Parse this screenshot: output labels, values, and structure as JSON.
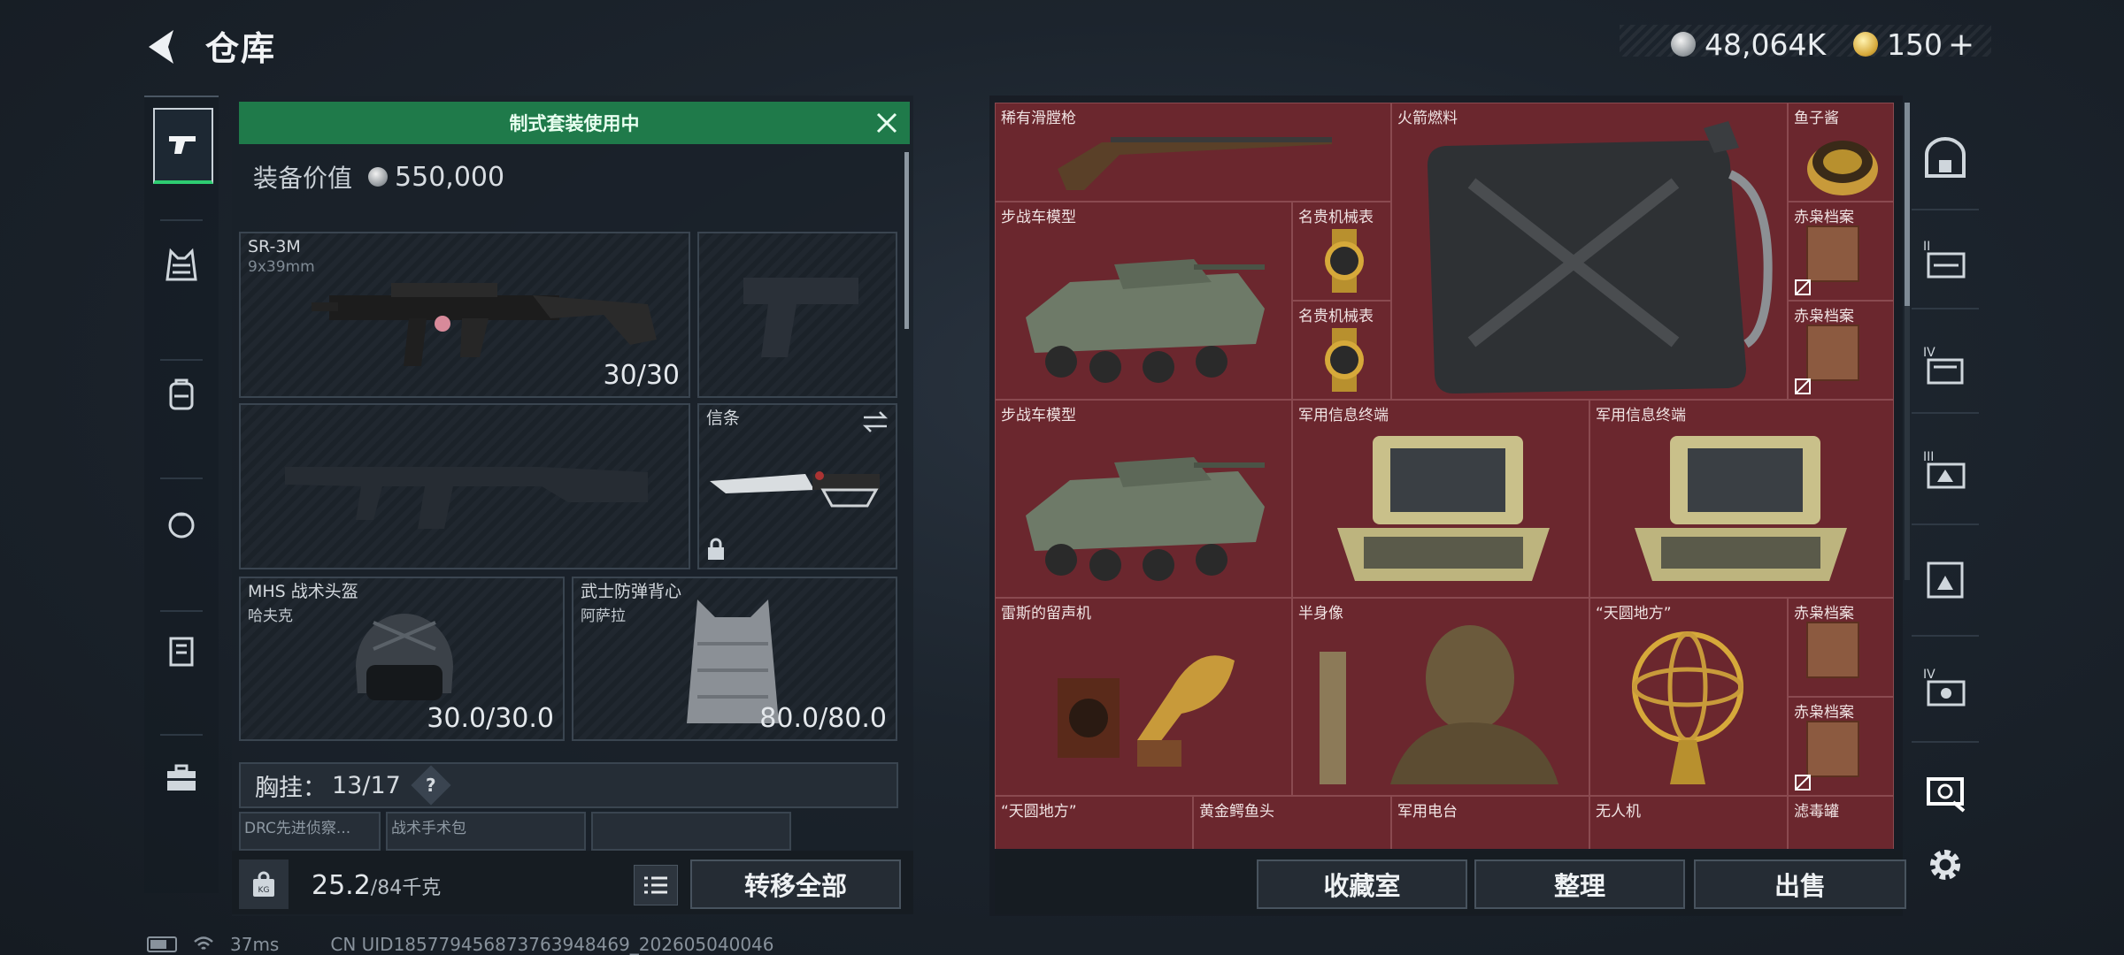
{
  "header": {
    "title": "仓库",
    "currency_silver": "48,064K",
    "currency_gold": "150",
    "plus": "+"
  },
  "loadout": {
    "banner": "制式套装使用中",
    "value_label": "装备价值",
    "value": "550,000",
    "primary": {
      "name": "SR-3M",
      "caliber": "9x39mm",
      "ammo": "30/30"
    },
    "melee": {
      "name": "信条"
    },
    "helmet": {
      "name": "MHS 战术头盔",
      "sub": "哈夫克",
      "durability": "30.0/30.0"
    },
    "armor": {
      "name": "武士防弹背心",
      "sub": "阿萨拉",
      "durability": "80.0/80.0"
    },
    "chest": {
      "label": "胸挂：",
      "capacity": "13/17",
      "help": "?"
    },
    "mini_slots": [
      "DRC先进侦察...",
      "战术手术包",
      ""
    ],
    "weight": "25.2",
    "weight_max": "/84千克",
    "transfer_all": "转移全部"
  },
  "stash": {
    "items": [
      {
        "label": "稀有滑膛枪"
      },
      {
        "label": "火箭燃料"
      },
      {
        "label": "鱼子酱"
      },
      {
        "label": "步战车模型"
      },
      {
        "label": "名贵机械表"
      },
      {
        "label": "赤枭档案"
      },
      {
        "label": "名贵机械表"
      },
      {
        "label": "赤枭档案"
      },
      {
        "label": "步战车模型"
      },
      {
        "label": "军用信息终端"
      },
      {
        "label": "军用信息终端"
      },
      {
        "label": "雷斯的留声机"
      },
      {
        "label": "半身像"
      },
      {
        "label": "“天圆地方”"
      },
      {
        "label": "赤枭档案"
      },
      {
        "label": "赤枭档案"
      },
      {
        "label": "“天圆地方”"
      },
      {
        "label": "黄金鳄鱼头"
      },
      {
        "label": "军用电台"
      },
      {
        "label": "无人机"
      },
      {
        "label": "滤毒罐"
      }
    ],
    "buttons": {
      "collection": "收藏室",
      "sort": "整理",
      "sell": "出售"
    }
  },
  "status": {
    "ping": "37ms",
    "uid": "CN UID185779456873763948469_202605040046"
  },
  "colors": {
    "accent_green": "#1f7a4a",
    "stash_red": "#6b272e"
  }
}
